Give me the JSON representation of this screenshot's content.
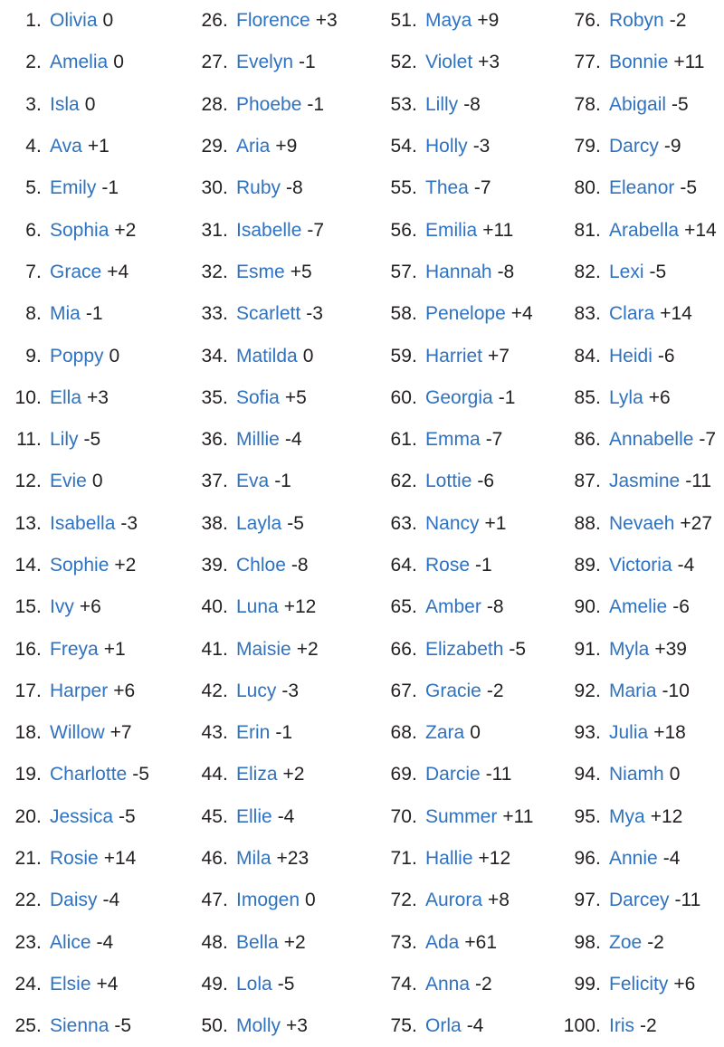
{
  "page": {
    "title": "Top 100 Baby Names",
    "accent_color": "#2f72c0",
    "text_color": "#231f20",
    "background_color": "#ffffff",
    "column_count": 4,
    "rows_per_column": 25,
    "total_entries": 100
  },
  "columns": [
    {
      "entries": [
        {
          "rank": "1.",
          "name": "Olivia",
          "delta": "0"
        },
        {
          "rank": "2.",
          "name": "Amelia",
          "delta": "0"
        },
        {
          "rank": "3.",
          "name": "Isla",
          "delta": "0"
        },
        {
          "rank": "4.",
          "name": "Ava",
          "delta": "+1"
        },
        {
          "rank": "5.",
          "name": "Emily",
          "delta": "-1"
        },
        {
          "rank": "6.",
          "name": "Sophia",
          "delta": "+2"
        },
        {
          "rank": "7.",
          "name": "Grace",
          "delta": "+4"
        },
        {
          "rank": "8.",
          "name": "Mia",
          "delta": "-1"
        },
        {
          "rank": "9.",
          "name": "Poppy",
          "delta": "0"
        },
        {
          "rank": "10.",
          "name": "Ella",
          "delta": "+3"
        },
        {
          "rank": "11.",
          "name": "Lily",
          "delta": "-5"
        },
        {
          "rank": "12.",
          "name": "Evie",
          "delta": "0"
        },
        {
          "rank": "13.",
          "name": "Isabella",
          "delta": "-3"
        },
        {
          "rank": "14.",
          "name": "Sophie",
          "delta": "+2"
        },
        {
          "rank": "15.",
          "name": "Ivy",
          "delta": "+6"
        },
        {
          "rank": "16.",
          "name": "Freya",
          "delta": "+1"
        },
        {
          "rank": "17.",
          "name": "Harper",
          "delta": "+6"
        },
        {
          "rank": "18.",
          "name": "Willow",
          "delta": "+7"
        },
        {
          "rank": "19.",
          "name": "Charlotte",
          "delta": "-5"
        },
        {
          "rank": "20.",
          "name": "Jessica",
          "delta": "-5"
        },
        {
          "rank": "21.",
          "name": "Rosie",
          "delta": "+14"
        },
        {
          "rank": "22.",
          "name": "Daisy",
          "delta": "-4"
        },
        {
          "rank": "23.",
          "name": "Alice",
          "delta": "-4"
        },
        {
          "rank": "24.",
          "name": "Elsie",
          "delta": "+4"
        },
        {
          "rank": "25.",
          "name": "Sienna",
          "delta": "-5"
        }
      ]
    },
    {
      "entries": [
        {
          "rank": "26.",
          "name": "Florence",
          "delta": "+3"
        },
        {
          "rank": "27.",
          "name": "Evelyn",
          "delta": "-1"
        },
        {
          "rank": "28.",
          "name": "Phoebe",
          "delta": "-1"
        },
        {
          "rank": "29.",
          "name": "Aria",
          "delta": "+9"
        },
        {
          "rank": "30.",
          "name": "Ruby",
          "delta": "-8"
        },
        {
          "rank": "31.",
          "name": "Isabelle",
          "delta": "-7"
        },
        {
          "rank": "32.",
          "name": "Esme",
          "delta": "+5"
        },
        {
          "rank": "33.",
          "name": "Scarlett",
          "delta": "-3"
        },
        {
          "rank": "34.",
          "name": "Matilda",
          "delta": "0"
        },
        {
          "rank": "35.",
          "name": "Sofia",
          "delta": "+5"
        },
        {
          "rank": "36.",
          "name": "Millie",
          "delta": "-4"
        },
        {
          "rank": "37.",
          "name": "Eva",
          "delta": "-1"
        },
        {
          "rank": "38.",
          "name": "Layla",
          "delta": "-5"
        },
        {
          "rank": "39.",
          "name": "Chloe",
          "delta": "-8"
        },
        {
          "rank": "40.",
          "name": "Luna",
          "delta": "+12"
        },
        {
          "rank": "41.",
          "name": "Maisie",
          "delta": "+2"
        },
        {
          "rank": "42.",
          "name": "Lucy",
          "delta": "-3"
        },
        {
          "rank": "43.",
          "name": "Erin",
          "delta": "-1"
        },
        {
          "rank": "44.",
          "name": "Eliza",
          "delta": "+2"
        },
        {
          "rank": "45.",
          "name": "Ellie",
          "delta": "-4"
        },
        {
          "rank": "46.",
          "name": "Mila",
          "delta": "+23"
        },
        {
          "rank": "47.",
          "name": "Imogen",
          "delta": "0"
        },
        {
          "rank": "48.",
          "name": "Bella",
          "delta": "+2"
        },
        {
          "rank": "49.",
          "name": "Lola",
          "delta": "-5"
        },
        {
          "rank": "50.",
          "name": "Molly",
          "delta": "+3"
        }
      ]
    },
    {
      "entries": [
        {
          "rank": "51.",
          "name": "Maya",
          "delta": "+9"
        },
        {
          "rank": "52.",
          "name": "Violet",
          "delta": "+3"
        },
        {
          "rank": "53.",
          "name": "Lilly",
          "delta": "-8"
        },
        {
          "rank": "54.",
          "name": "Holly",
          "delta": "-3"
        },
        {
          "rank": "55.",
          "name": "Thea",
          "delta": "-7"
        },
        {
          "rank": "56.",
          "name": "Emilia",
          "delta": "+11"
        },
        {
          "rank": "57.",
          "name": "Hannah",
          "delta": "-8"
        },
        {
          "rank": "58.",
          "name": "Penelope",
          "delta": "+4"
        },
        {
          "rank": "59.",
          "name": "Harriet",
          "delta": "+7"
        },
        {
          "rank": "60.",
          "name": "Georgia",
          "delta": "-1"
        },
        {
          "rank": "61.",
          "name": "Emma",
          "delta": "-7"
        },
        {
          "rank": "62.",
          "name": "Lottie",
          "delta": "-6"
        },
        {
          "rank": "63.",
          "name": "Nancy",
          "delta": "+1"
        },
        {
          "rank": "64.",
          "name": "Rose",
          "delta": "-1"
        },
        {
          "rank": "65.",
          "name": "Amber",
          "delta": "-8"
        },
        {
          "rank": "66.",
          "name": "Elizabeth",
          "delta": "-5"
        },
        {
          "rank": "67.",
          "name": "Gracie",
          "delta": "-2"
        },
        {
          "rank": "68.",
          "name": "Zara",
          "delta": "0"
        },
        {
          "rank": "69.",
          "name": "Darcie",
          "delta": "-11"
        },
        {
          "rank": "70.",
          "name": "Summer",
          "delta": "+11"
        },
        {
          "rank": "71.",
          "name": "Hallie",
          "delta": "+12"
        },
        {
          "rank": "72.",
          "name": "Aurora",
          "delta": "+8"
        },
        {
          "rank": "73.",
          "name": "Ada",
          "delta": "+61"
        },
        {
          "rank": "74.",
          "name": "Anna",
          "delta": "-2"
        },
        {
          "rank": "75.",
          "name": "Orla",
          "delta": "-4"
        }
      ]
    },
    {
      "entries": [
        {
          "rank": "76.",
          "name": "Robyn",
          "delta": "-2"
        },
        {
          "rank": "77.",
          "name": "Bonnie",
          "delta": "+11"
        },
        {
          "rank": "78.",
          "name": "Abigail",
          "delta": "-5"
        },
        {
          "rank": "79.",
          "name": "Darcy",
          "delta": "-9"
        },
        {
          "rank": "80.",
          "name": "Eleanor",
          "delta": "-5"
        },
        {
          "rank": "81.",
          "name": "Arabella",
          "delta": "+14"
        },
        {
          "rank": "82.",
          "name": "Lexi",
          "delta": "-5"
        },
        {
          "rank": "83.",
          "name": "Clara",
          "delta": "+14"
        },
        {
          "rank": "84.",
          "name": "Heidi",
          "delta": "-6"
        },
        {
          "rank": "85.",
          "name": "Lyla",
          "delta": "+6"
        },
        {
          "rank": "86.",
          "name": "Annabelle",
          "delta": "-7"
        },
        {
          "rank": "87.",
          "name": "Jasmine",
          "delta": "-11"
        },
        {
          "rank": "88.",
          "name": "Nevaeh",
          "delta": "+27"
        },
        {
          "rank": "89.",
          "name": "Victoria",
          "delta": "-4"
        },
        {
          "rank": "90.",
          "name": "Amelie",
          "delta": "-6"
        },
        {
          "rank": "91.",
          "name": "Myla",
          "delta": "+39"
        },
        {
          "rank": "92.",
          "name": "Maria",
          "delta": "-10"
        },
        {
          "rank": "93.",
          "name": "Julia",
          "delta": "+18"
        },
        {
          "rank": "94.",
          "name": "Niamh",
          "delta": "0"
        },
        {
          "rank": "95.",
          "name": "Mya",
          "delta": "+12"
        },
        {
          "rank": "96.",
          "name": "Annie",
          "delta": "-4"
        },
        {
          "rank": "97.",
          "name": "Darcey",
          "delta": "-11"
        },
        {
          "rank": "98.",
          "name": "Zoe",
          "delta": "-2"
        },
        {
          "rank": "99.",
          "name": "Felicity",
          "delta": "+6"
        },
        {
          "rank": "100.",
          "name": "Iris",
          "delta": "-2"
        }
      ]
    }
  ]
}
